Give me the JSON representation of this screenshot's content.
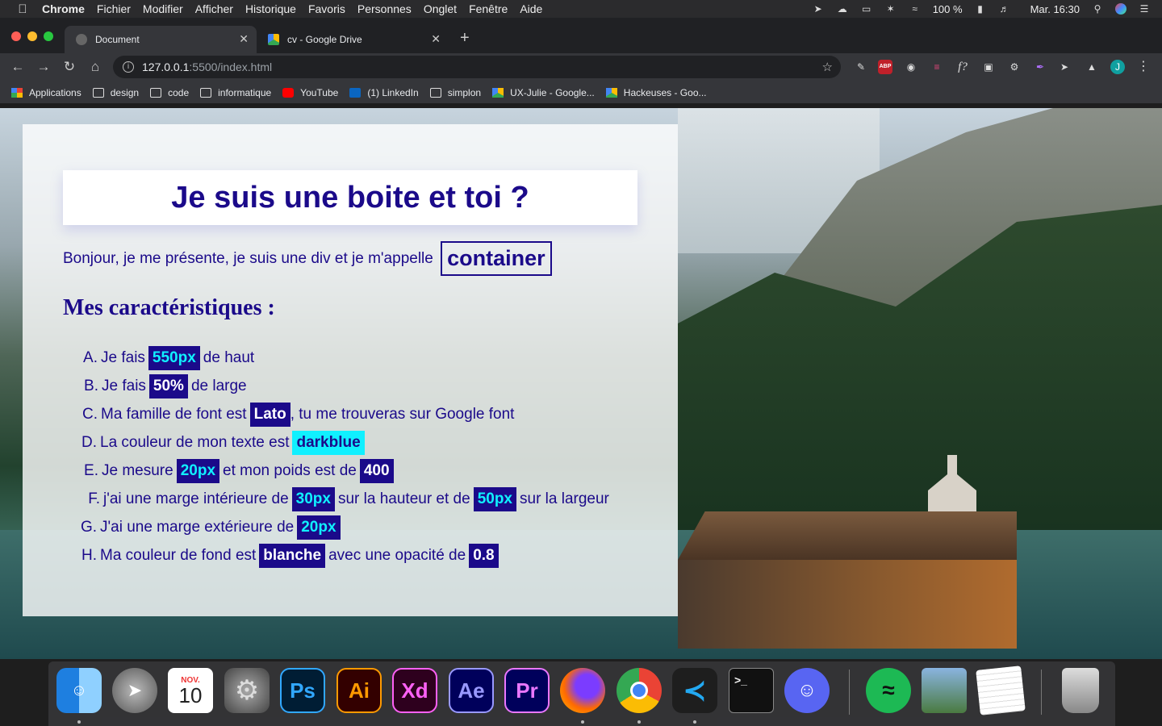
{
  "menubar": {
    "app": "Chrome",
    "items": [
      "Fichier",
      "Modifier",
      "Afficher",
      "Historique",
      "Favoris",
      "Personnes",
      "Onglet",
      "Fenêtre",
      "Aide"
    ],
    "battery": "100 %",
    "clock": "Mar. 16:30"
  },
  "tabs": [
    {
      "title": "Document",
      "active": true
    },
    {
      "title": "cv - Google Drive",
      "active": false
    }
  ],
  "omnibox": {
    "host": "127.0.0.1",
    "path": ":5500/index.html"
  },
  "bookmarks": [
    "Applications",
    "design",
    "code",
    "informatique",
    "YouTube",
    "(1) LinkedIn",
    "simplon",
    "UX-Julie - Google...",
    "Hackeuses - Goo..."
  ],
  "extensions": {
    "abp": "ABP",
    "formula": "f?",
    "avatar": "J"
  },
  "dock": {
    "calendar_month": "NOV.",
    "calendar_day": "10",
    "labels": [
      "Ps",
      "Ai",
      "Xd",
      "Ae",
      "Pr"
    ]
  },
  "page": {
    "title": "Je suis une boite et toi ?",
    "intro": "Bonjour, je me présente, je suis une div et je m'appelle",
    "intro_word": "container",
    "h2": "Mes caractéristiques :",
    "items": [
      {
        "letter": "A.",
        "parts": [
          "Je fais",
          "550px",
          "de haut"
        ]
      },
      {
        "letter": "B.",
        "parts": [
          "Je fais",
          "50%",
          "de large"
        ]
      },
      {
        "letter": "C.",
        "parts": [
          "Ma famille de font est",
          "Lato",
          ", tu me trouveras sur Google font"
        ]
      },
      {
        "letter": "D.",
        "parts": [
          "La couleur de mon texte est",
          "darkblue"
        ]
      },
      {
        "letter": "E.",
        "parts": [
          "Je mesure",
          "20px",
          "et mon poids est de",
          "400"
        ]
      },
      {
        "letter": "F.",
        "parts": [
          "j'ai une marge intérieure de",
          "30px",
          "sur la hauteur et de",
          "50px",
          "sur la largeur"
        ]
      },
      {
        "letter": "G.",
        "parts": [
          "J'ai une marge extérieure de",
          "20px"
        ]
      },
      {
        "letter": "H.",
        "parts": [
          "Ma couleur de fond est",
          "blanche",
          "avec une opacité de",
          "0.8"
        ]
      }
    ]
  },
  "colors": {
    "darkblue": "#1b0a8a",
    "cyan": "#10f0ff"
  }
}
